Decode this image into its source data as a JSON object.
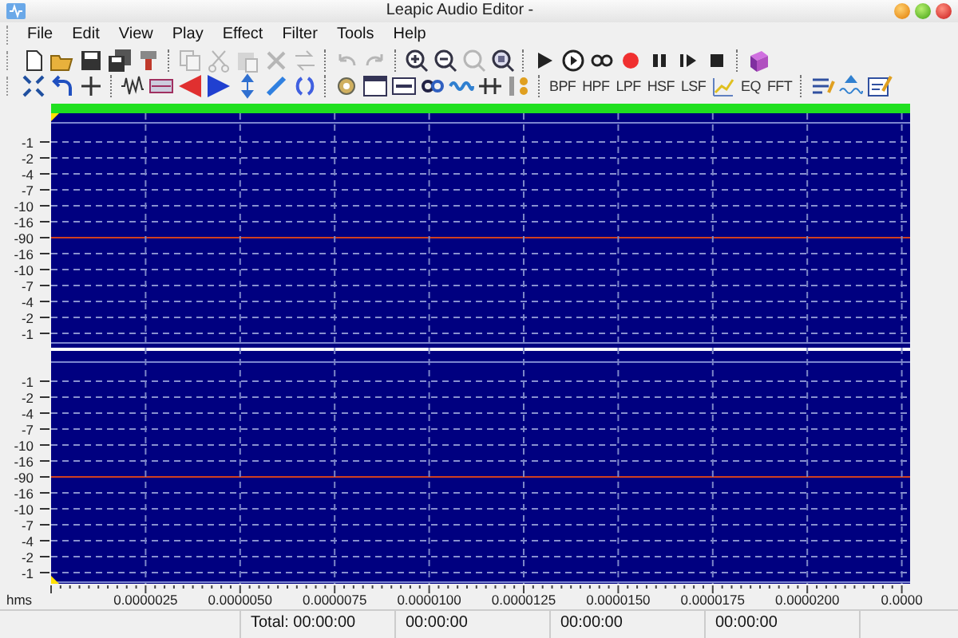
{
  "window": {
    "title": "Leapic Audio Editor -"
  },
  "menu": [
    "File",
    "Edit",
    "View",
    "Play",
    "Effect",
    "Filter",
    "Tools",
    "Help"
  ],
  "toolbar_1": [
    {
      "kind": "icon",
      "disabled": false
    },
    {
      "kind": "icon",
      "disabled": false
    },
    {
      "kind": "icon",
      "disabled": false
    },
    {
      "kind": "icon",
      "disabled": false
    },
    {
      "kind": "icon",
      "disabled": false
    },
    {
      "kind": "separator"
    },
    {
      "kind": "icon",
      "disabled": true
    },
    {
      "kind": "icon",
      "disabled": true
    },
    {
      "kind": "icon",
      "disabled": true
    },
    {
      "kind": "icon",
      "disabled": true
    },
    {
      "kind": "icon",
      "disabled": true
    },
    {
      "kind": "separator"
    },
    {
      "kind": "icon",
      "disabled": true
    },
    {
      "kind": "icon",
      "disabled": true
    },
    {
      "kind": "separator"
    },
    {
      "kind": "icon",
      "disabled": false
    },
    {
      "kind": "icon",
      "disabled": false
    },
    {
      "kind": "icon",
      "disabled": true
    },
    {
      "kind": "icon",
      "disabled": false
    },
    {
      "kind": "separator"
    },
    {
      "kind": "icon",
      "disabled": false
    },
    {
      "kind": "icon",
      "disabled": false
    },
    {
      "kind": "icon",
      "disabled": false
    },
    {
      "kind": "icon",
      "disabled": false
    },
    {
      "kind": "icon",
      "disabled": false
    },
    {
      "kind": "icon",
      "disabled": false
    },
    {
      "kind": "icon",
      "disabled": false
    },
    {
      "kind": "separator"
    },
    {
      "kind": "icon",
      "disabled": false
    }
  ],
  "toolbar_2": [
    {
      "kind": "icon"
    },
    {
      "kind": "icon"
    },
    {
      "kind": "icon"
    },
    {
      "kind": "separator"
    },
    {
      "kind": "icon"
    },
    {
      "kind": "icon"
    },
    {
      "kind": "icon"
    },
    {
      "kind": "icon"
    },
    {
      "kind": "icon"
    },
    {
      "kind": "icon"
    },
    {
      "kind": "icon"
    },
    {
      "kind": "separator"
    },
    {
      "kind": "icon"
    },
    {
      "kind": "icon"
    },
    {
      "kind": "icon"
    },
    {
      "kind": "icon"
    },
    {
      "kind": "icon"
    },
    {
      "kind": "icon"
    },
    {
      "kind": "icon"
    },
    {
      "kind": "separator"
    },
    {
      "kind": "text",
      "label": "BPF"
    },
    {
      "kind": "text",
      "label": "HPF"
    },
    {
      "kind": "text",
      "label": "LPF"
    },
    {
      "kind": "text",
      "label": "HSF"
    },
    {
      "kind": "text",
      "label": "LSF"
    },
    {
      "kind": "icon"
    },
    {
      "kind": "text",
      "label": "EQ"
    },
    {
      "kind": "text",
      "label": "FFT"
    },
    {
      "kind": "separator"
    },
    {
      "kind": "icon"
    },
    {
      "kind": "icon"
    },
    {
      "kind": "icon"
    }
  ],
  "waveform": {
    "channels": [
      {
        "scale": [
          "-1",
          "-2",
          "-4",
          "-7",
          "-10",
          "-16",
          "-90",
          "-16",
          "-10",
          "-7",
          "-4",
          "-2",
          "-1"
        ]
      },
      {
        "scale": [
          "-1",
          "-2",
          "-4",
          "-7",
          "-10",
          "-16",
          "-90",
          "-16",
          "-10",
          "-7",
          "-4",
          "-2",
          "-1"
        ]
      }
    ],
    "time_unit": "hms",
    "time_labels": [
      "0.0000025",
      "0.0000050",
      "0.0000075",
      "0.0000100",
      "0.0000125",
      "0.0000150",
      "0.0000175",
      "0.0000200",
      "0.0000"
    ]
  },
  "status_bar": [
    "Total: 00:00:00",
    "00:00:00",
    "00:00:00",
    "00:00:00"
  ]
}
